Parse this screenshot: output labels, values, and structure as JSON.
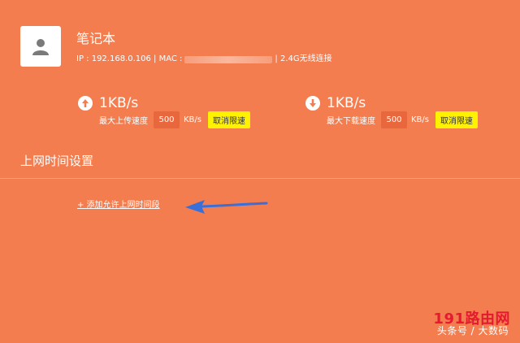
{
  "device": {
    "name": "笔记本",
    "ip_label": "IP : 192.168.0.106 | MAC :",
    "connection": "| 2.4G无线连接"
  },
  "upload": {
    "speed": "1KB/s",
    "label": "最大上传速度",
    "limit": "500",
    "unit": "KB/s",
    "cancel": "取消限速"
  },
  "download": {
    "speed": "1KB/s",
    "label": "最大下载速度",
    "limit": "500",
    "unit": "KB/s",
    "cancel": "取消限速"
  },
  "section": {
    "title": "上网时间设置",
    "add_link": "+ 添加允许上网时间段"
  },
  "watermark": {
    "brand": "191路由网",
    "caption": "头条号 / 大数码"
  },
  "colors": {
    "background": "#F47D4F",
    "button": "#FFF200",
    "input": "#E9673C",
    "arrow": "#3A6FD8"
  },
  "icons": [
    "user-icon",
    "upload-arrow-icon",
    "download-arrow-icon",
    "pointer-arrow-icon"
  ]
}
